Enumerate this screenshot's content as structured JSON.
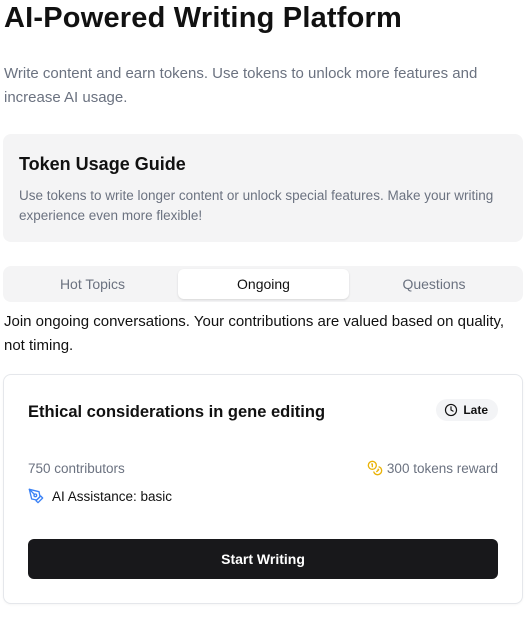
{
  "header": {
    "title": "AI-Powered Writing Platform",
    "description": "Write content and earn tokens. Use tokens to unlock more features and increase AI usage."
  },
  "guide": {
    "title": "Token Usage Guide",
    "text": "Use tokens to write longer content or unlock special features. Make your writing experience even more flexible!"
  },
  "tabs": [
    {
      "label": "Hot Topics",
      "active": false
    },
    {
      "label": "Ongoing",
      "active": true
    },
    {
      "label": "Questions",
      "active": false
    }
  ],
  "ongoing": {
    "description": "Join ongoing conversations. Your contributions are valued based on quality, not timing."
  },
  "topic": {
    "title": "Ethical considerations in gene editing",
    "badge": "Late",
    "badge_icon": "clock-icon",
    "contributors": "750 contributors",
    "reward": "300 tokens reward",
    "reward_icon": "coins-icon",
    "assistance": "AI Assistance: basic",
    "assistance_icon": "pen-tool-icon",
    "button_label": "Start Writing"
  },
  "colors": {
    "coin": "#eab308",
    "assist": "#3b82f6",
    "button": "#18181b"
  }
}
